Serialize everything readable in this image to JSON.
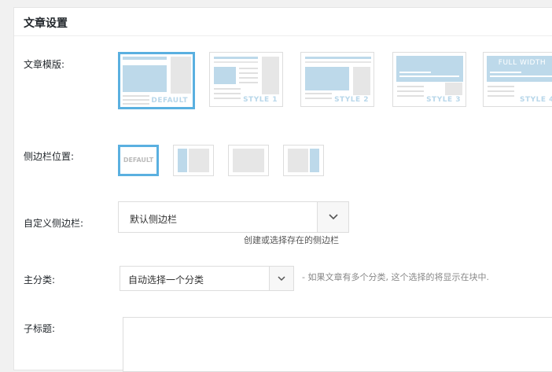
{
  "panel": {
    "title": "文章设置"
  },
  "template": {
    "label": "文章模版:",
    "options": [
      {
        "tag": "DEFAULT",
        "selected": true
      },
      {
        "tag": "STYLE 1",
        "selected": false
      },
      {
        "tag": "STYLE 2",
        "selected": false
      },
      {
        "tag": "STYLE 3",
        "selected": false
      },
      {
        "tag": "STYLE 4",
        "selected": false,
        "banner": "FULL WIDTH"
      }
    ]
  },
  "sidebar_position": {
    "label": "侧边栏位置:",
    "options": [
      {
        "name": "default",
        "text": "DEFAULT",
        "selected": true
      },
      {
        "name": "left",
        "selected": false
      },
      {
        "name": "none",
        "selected": false
      },
      {
        "name": "right",
        "selected": false
      }
    ]
  },
  "custom_sidebar": {
    "label": "自定义侧边栏:",
    "value": "默认侧边栏",
    "hint": "创建或选择存在的侧边栏"
  },
  "main_category": {
    "label": "主分类:",
    "value": "自动选择一个分类",
    "hint": "- 如果文章有多个分类, 这个选择的将显示在块中."
  },
  "subtitle": {
    "label": "子标题:",
    "value": ""
  },
  "colors": {
    "accent": "#5ab0e0",
    "thumb_blue": "#bdd9ea",
    "thumb_grey": "#e6e6e6"
  }
}
